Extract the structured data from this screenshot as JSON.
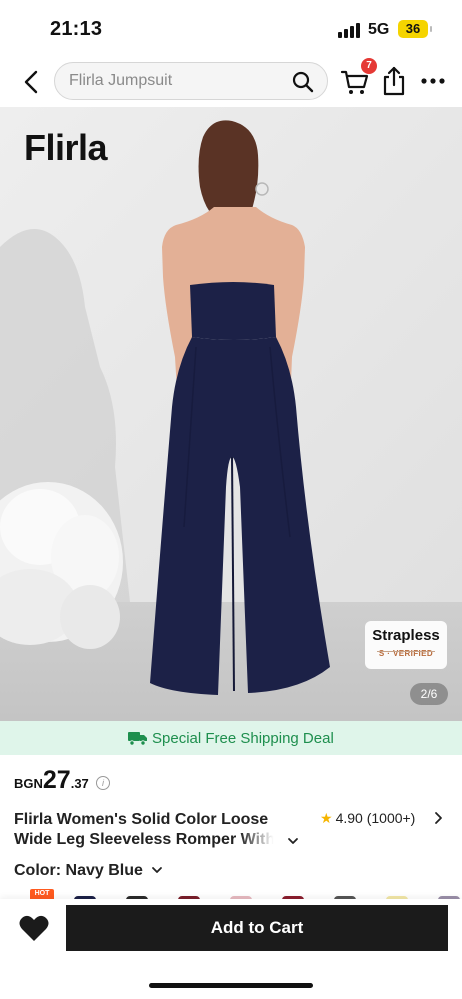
{
  "status_bar": {
    "time": "21:13",
    "network": "5G",
    "battery": "36"
  },
  "header": {
    "search_placeholder": "Flirla Jumpsuit",
    "cart_count": "7",
    "icons": [
      "back-arrow-icon",
      "search-icon",
      "cart-icon",
      "share-icon",
      "more-icon"
    ]
  },
  "gallery": {
    "brand": "Flirla",
    "tag_title": "Strapless",
    "tag_subtitle": "S · VERIFIED",
    "page_indicator": "2/6",
    "garment_color": "#1c2147"
  },
  "shipping": {
    "text": "Special Free Shipping Deal",
    "color": "#1e8f4e",
    "background": "#dff5ea"
  },
  "price": {
    "currency": "BGN",
    "integer": "27",
    "decimal": ".37"
  },
  "product": {
    "title": "Flirla Women's Solid Color Loose Wide Leg Sleeveless Romper With",
    "rating": "4.90",
    "review_count": "(1000+)"
  },
  "color": {
    "label": "Color: Navy Blue",
    "hot_label": "HOT",
    "swatches": [
      "#1c2147",
      "#2b2b2b",
      "#7a1f2b",
      "#e7b9c0",
      "#8b1e2e",
      "#555555",
      "#f2e7a6",
      "#9a8fa8"
    ]
  },
  "bottom_bar": {
    "add_to_cart": "Add to Cart"
  }
}
